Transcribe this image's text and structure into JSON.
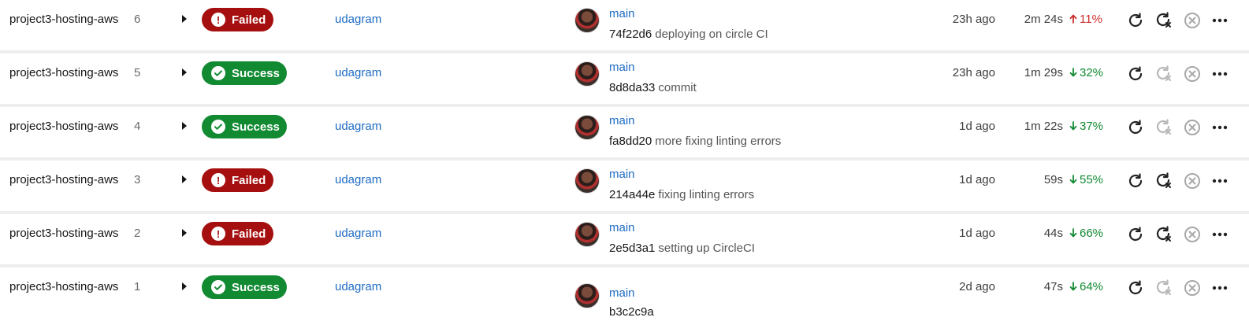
{
  "pipelines": [
    {
      "project": "project3-hosting-aws",
      "number": "6",
      "status": "Failed",
      "status_type": "failed",
      "repo": "udagram",
      "branch": "main",
      "sha": "74f22d6",
      "message": "deploying on circle CI",
      "ago": "23h ago",
      "duration": "2m 24s",
      "change": "11%",
      "change_dir": "up",
      "rerun_failed_enabled": true
    },
    {
      "project": "project3-hosting-aws",
      "number": "5",
      "status": "Success",
      "status_type": "success",
      "repo": "udagram",
      "branch": "main",
      "sha": "8d8da33",
      "message": "commit",
      "ago": "23h ago",
      "duration": "1m 29s",
      "change": "32%",
      "change_dir": "down",
      "rerun_failed_enabled": false
    },
    {
      "project": "project3-hosting-aws",
      "number": "4",
      "status": "Success",
      "status_type": "success",
      "repo": "udagram",
      "branch": "main",
      "sha": "fa8dd20",
      "message": "more fixing linting errors",
      "ago": "1d ago",
      "duration": "1m 22s",
      "change": "37%",
      "change_dir": "down",
      "rerun_failed_enabled": false
    },
    {
      "project": "project3-hosting-aws",
      "number": "3",
      "status": "Failed",
      "status_type": "failed",
      "repo": "udagram",
      "branch": "main",
      "sha": "214a44e",
      "message": "fixing linting errors",
      "ago": "1d ago",
      "duration": "59s",
      "change": "55%",
      "change_dir": "down",
      "rerun_failed_enabled": true
    },
    {
      "project": "project3-hosting-aws",
      "number": "2",
      "status": "Failed",
      "status_type": "failed",
      "repo": "udagram",
      "branch": "main",
      "sha": "2e5d3a1",
      "message": "setting up CircleCI",
      "ago": "1d ago",
      "duration": "44s",
      "change": "66%",
      "change_dir": "down",
      "rerun_failed_enabled": true
    },
    {
      "project": "project3-hosting-aws",
      "number": "1",
      "status": "Success",
      "status_type": "success",
      "repo": "udagram",
      "branch": "main",
      "sha": "b3c2c9a",
      "message": "",
      "ago": "2d ago",
      "duration": "47s",
      "change": "64%",
      "change_dir": "down",
      "rerun_failed_enabled": false
    }
  ],
  "colors": {
    "failed": "#a50f0f",
    "success": "#118a32",
    "link": "#1e6bc4",
    "up": "#cc2b2b",
    "down": "#118a32"
  },
  "icons": {
    "expand": "caret-right-icon",
    "rerun": "rerun-icon",
    "rerun_failed": "rerun-failed-icon",
    "cancel": "cancel-icon",
    "more": "more-icon"
  }
}
